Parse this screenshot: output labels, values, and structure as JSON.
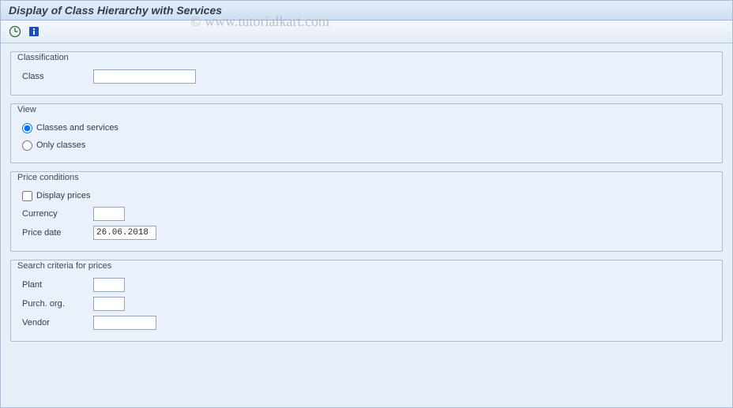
{
  "title": "Display of Class Hierarchy with Services",
  "watermark": "© www.tutorialkart.com",
  "toolbar": {
    "execute_icon": "execute-icon",
    "info_icon": "info-icon"
  },
  "groups": {
    "classification": {
      "legend": "Classification",
      "class_label": "Class",
      "class_value": ""
    },
    "view": {
      "legend": "View",
      "option1_label": "Classes and services",
      "option2_label": "Only classes",
      "selected": "option1"
    },
    "price_conditions": {
      "legend": "Price conditions",
      "display_prices_label": "Display prices",
      "display_prices_checked": false,
      "currency_label": "Currency",
      "currency_value": "",
      "price_date_label": "Price date",
      "price_date_value": "26.06.2018"
    },
    "search_criteria": {
      "legend": "Search criteria for prices",
      "plant_label": "Plant",
      "plant_value": "",
      "purch_org_label": "Purch. org.",
      "purch_org_value": "",
      "vendor_label": "Vendor",
      "vendor_value": ""
    }
  }
}
